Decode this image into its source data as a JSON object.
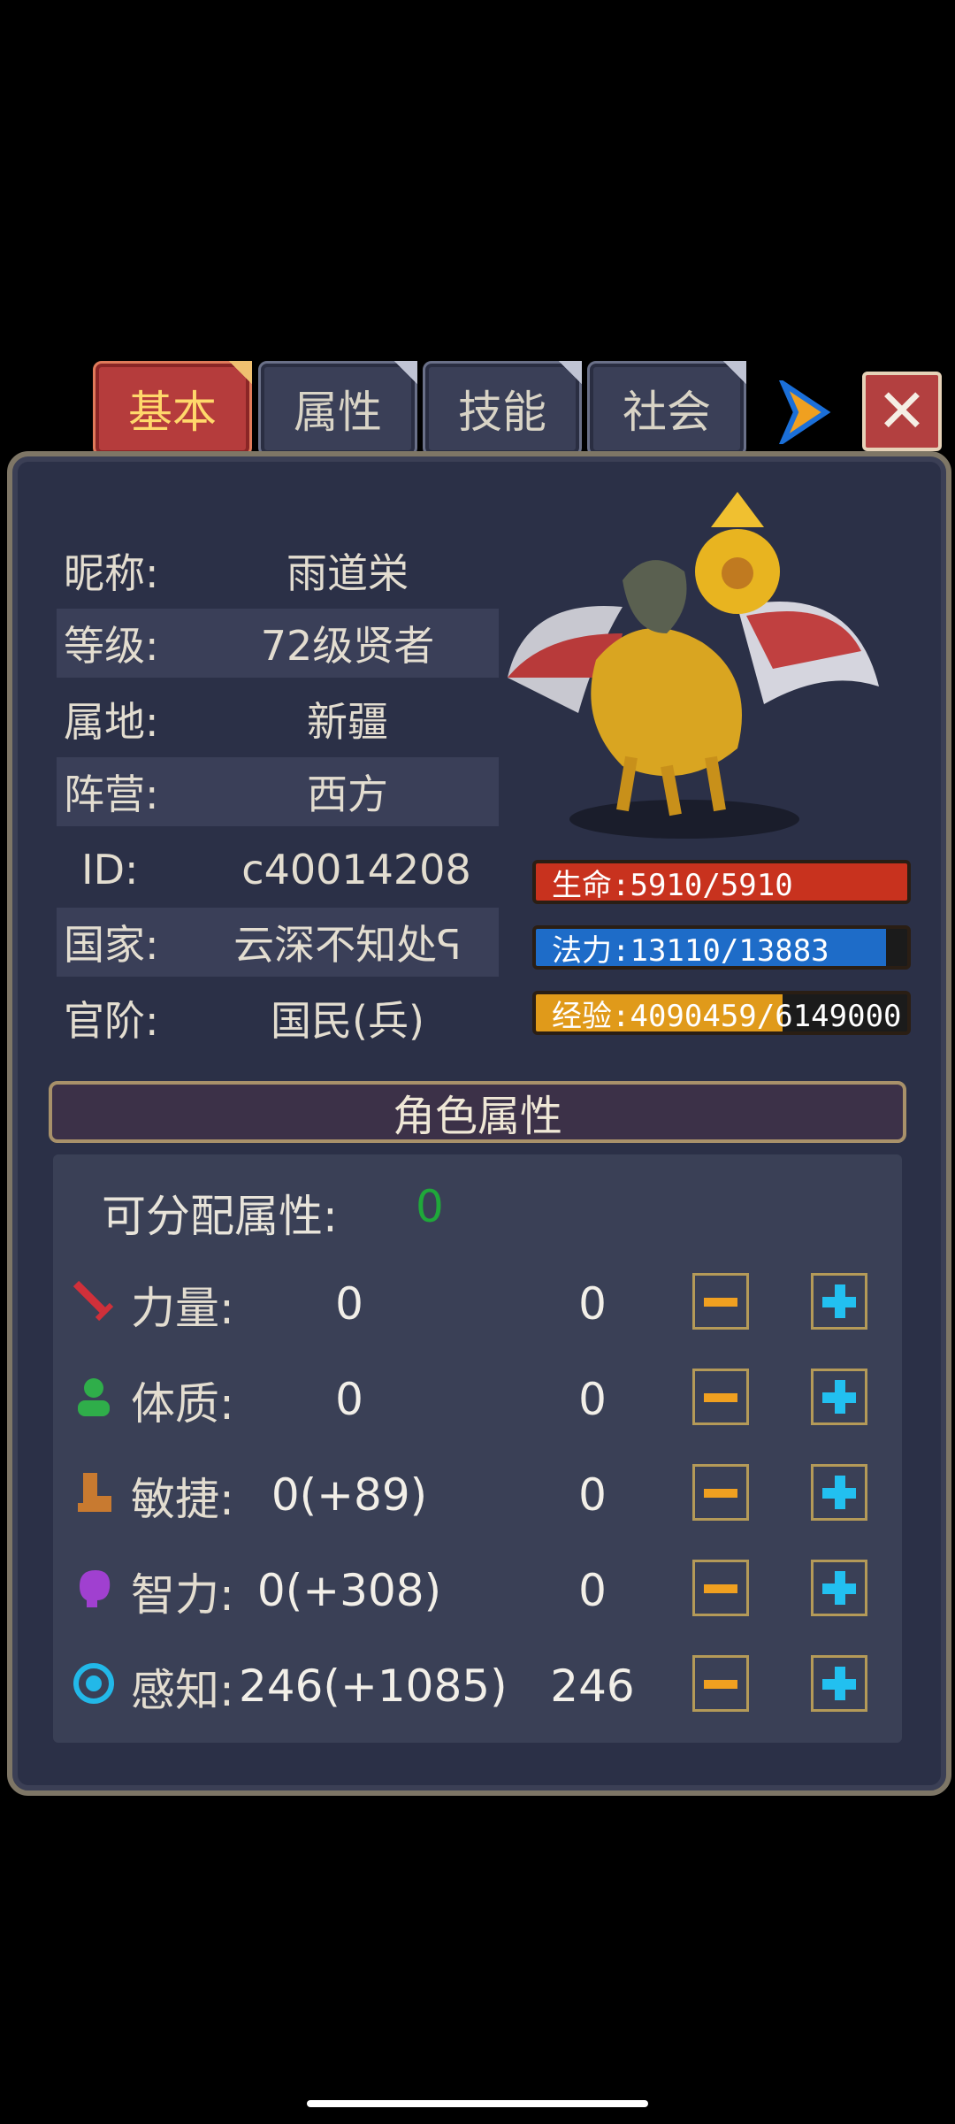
{
  "tabs": [
    {
      "label": "基本",
      "active": true
    },
    {
      "label": "属性",
      "active": false
    },
    {
      "label": "技能",
      "active": false
    },
    {
      "label": "社会",
      "active": false
    }
  ],
  "close_symbol": "✕",
  "info": {
    "nickname_label": "昵称:",
    "nickname": "雨道栄",
    "level_label": "等级:",
    "level": "72级贤者",
    "territory_label": "属地:",
    "territory": "新疆",
    "camp_label": "阵营:",
    "camp": "西方",
    "id_label": "ID:",
    "id": "c40014208",
    "country_label": "国家:",
    "country": "云深不知处ᕋ",
    "rank_label": "官阶:",
    "rank": "国民(兵)"
  },
  "bars": {
    "hp": {
      "text": "生命:5910/5910",
      "fraction": 1.0,
      "color": "#c8321e"
    },
    "mp": {
      "text": "法力:13110/13883",
      "fraction": 0.944,
      "color": "#1e6cc8"
    },
    "exp": {
      "text": "经验:4090459/6149000",
      "fraction": 0.665,
      "color": "#e09a1a"
    }
  },
  "attributes": {
    "header": "角色属性",
    "free_label": "可分配属性:",
    "free_value": "0",
    "rows": [
      {
        "label": "力量:",
        "base": "0",
        "added": "0",
        "icon": "sword-icon"
      },
      {
        "label": "体质:",
        "base": "0",
        "added": "0",
        "icon": "person-icon"
      },
      {
        "label": "敏捷:",
        "base": "0(+89)",
        "added": "0",
        "icon": "boot-icon"
      },
      {
        "label": "智力:",
        "base": "0(+308)",
        "added": "0",
        "icon": "brain-icon"
      },
      {
        "label": "感知:",
        "base": "246(+1085)",
        "added": "246",
        "icon": "eye-icon"
      }
    ]
  },
  "colors": {
    "accent_green": "#1fa83a",
    "minus": "#f0a020",
    "plus": "#22c0f0"
  }
}
